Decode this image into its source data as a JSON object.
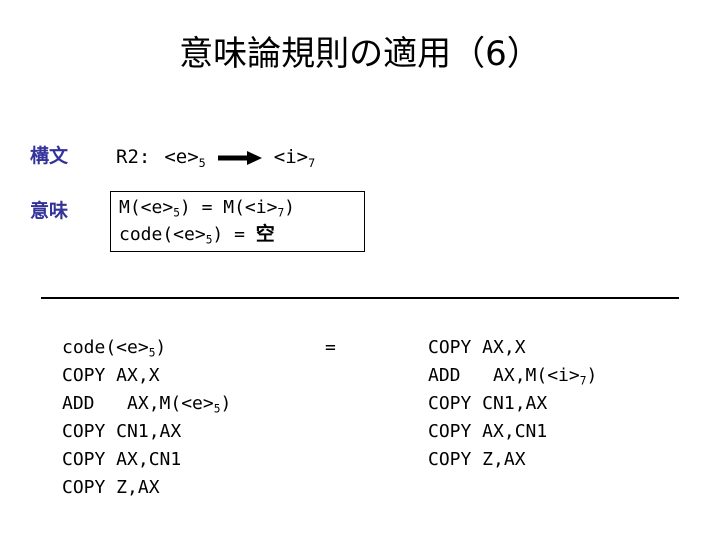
{
  "slide": {
    "title": "意味論規則の適用（6）",
    "background_color": "#ffffff",
    "label_color": "#333399",
    "text_color": "#000000"
  },
  "rows": {
    "syntax_label": "構文",
    "semantics_label": "意味"
  },
  "rule": {
    "name": "R2:",
    "lhs_base": "<e>",
    "lhs_sub": "5",
    "arrow_icon": "right-arrow-icon",
    "rhs_base": "<i>",
    "rhs_sub": "7"
  },
  "semantics_box": {
    "line1": {
      "part1": "M(<e>",
      "sub1": "5",
      "part2": ")  =  M(<i>",
      "sub2": "7",
      "part3": ")"
    },
    "line2": {
      "part1": "code(<e>",
      "sub1": "5",
      "part2": ")  =  ",
      "empty_symbol": "空"
    }
  },
  "derivation": {
    "equals": "=",
    "left_code": [
      {
        "text": "code(<e>",
        "sub": "5",
        "tail": ")"
      },
      {
        "text": "COPY AX,X",
        "sub": "",
        "tail": ""
      },
      {
        "text": "ADD   AX,M(<e>",
        "sub": "5",
        "tail": ")"
      },
      {
        "text": "COPY CN1,AX",
        "sub": "",
        "tail": ""
      },
      {
        "text": "COPY AX,CN1",
        "sub": "",
        "tail": ""
      },
      {
        "text": "COPY Z,AX",
        "sub": "",
        "tail": ""
      }
    ],
    "right_code": [
      {
        "text": "COPY AX,X",
        "sub": "",
        "tail": ""
      },
      {
        "text": "ADD   AX,M(<i>",
        "sub": "7",
        "tail": ")"
      },
      {
        "text": "COPY CN1,AX",
        "sub": "",
        "tail": ""
      },
      {
        "text": "COPY AX,CN1",
        "sub": "",
        "tail": ""
      },
      {
        "text": "COPY Z,AX",
        "sub": "",
        "tail": ""
      }
    ]
  }
}
